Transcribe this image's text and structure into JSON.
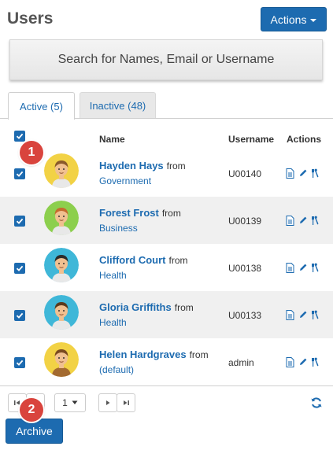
{
  "header": {
    "title": "Users",
    "actions_label": "Actions"
  },
  "search": {
    "placeholder": "Search for Names, Email or Username"
  },
  "tabs": [
    {
      "label": "Active (5)",
      "active": true
    },
    {
      "label": "Inactive (48)",
      "active": false
    }
  ],
  "table": {
    "columns": {
      "name": "Name",
      "username": "Username",
      "actions": "Actions"
    },
    "from_word": "from",
    "rows": [
      {
        "name": "Hayden Hays",
        "org": "Government",
        "username": "U00140",
        "checked": true,
        "avatar_bg": "#f2d245"
      },
      {
        "name": "Forest Frost",
        "org": "Business",
        "username": "U00139",
        "checked": true,
        "avatar_bg": "#8ccf4d"
      },
      {
        "name": "Clifford Court",
        "org": "Health",
        "username": "U00138",
        "checked": true,
        "avatar_bg": "#3fb7d8"
      },
      {
        "name": "Gloria Griffiths",
        "org": "Health",
        "username": "U00133",
        "checked": true,
        "avatar_bg": "#3fb7d8"
      },
      {
        "name": "Helen Hardgraves",
        "org": "(default)",
        "username": "admin",
        "checked": true,
        "avatar_bg": "#f2d245"
      }
    ]
  },
  "pager": {
    "page": "1"
  },
  "footer": {
    "archive_label": "Archive"
  },
  "badges": {
    "one": "1",
    "two": "2"
  },
  "colors": {
    "accent": "#1d6bb0",
    "badge": "#d9443d",
    "row_stripe": "#f0f0f0"
  },
  "icons": {
    "row_actions": [
      "document-icon",
      "pencil-icon",
      "tools-icon"
    ],
    "pager": [
      "first-page-icon",
      "previous-page-icon",
      "next-page-icon",
      "last-page-icon",
      "refresh-icon"
    ]
  }
}
